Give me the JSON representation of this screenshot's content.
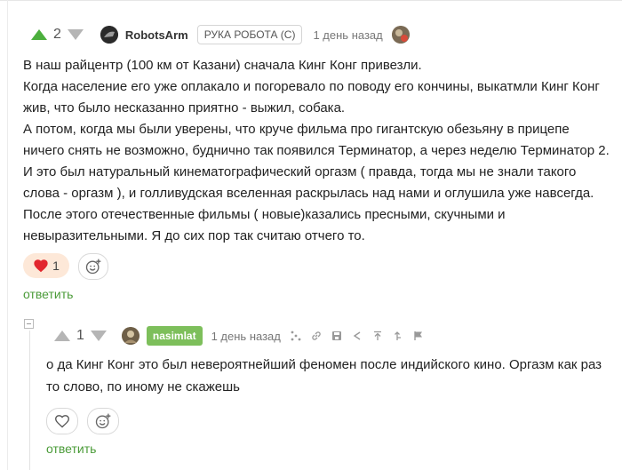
{
  "comment": {
    "rating": "2",
    "author": "RobotsArm",
    "badge": "РУКА РОБОТА (С)",
    "time": "1 день назад",
    "paragraphs": [
      "В наш райцентр (100 км от Казани) сначала Кинг Конг привезли.",
      "Когда население его уже оплакало и погоревало по поводу его кончины, выкатмли Кинг Конг жив, что было несказанно приятно - выжил, собака.",
      "А потом, когда мы были уверены, что круче фильма про гигантскую обезьяну в прицепе ничего снять не возможно, буднично так появился Терминатор, а через неделю Терминатор 2. И это был натуральный кинематографический оргазм ( правда, тогда мы не знали такого слова - оргазм ), и голливудская вселенная раскрылась над нами и оглушила уже навсегда.",
      "После этого отечественные фильмы ( новые)казались пресными, скучными и невыразительными. Я до сих пор так считаю отчего то."
    ],
    "likes": "1",
    "reply_label": "ответить"
  },
  "reply": {
    "rating": "1",
    "author": "nasimlat",
    "time": "1 день назад",
    "text": "о да Кинг Конг это был невероятнейший феномен после индийского кино. Оргазм как раз то слово, по иному не скажешь",
    "reply_label": "ответить"
  },
  "colors": {
    "vote_up": "#4caf3d",
    "vote_down": "#b5b5b5",
    "heart": "#e2262e",
    "reply_link": "#4a9b38",
    "nick_badge": "#7dbf5b"
  }
}
